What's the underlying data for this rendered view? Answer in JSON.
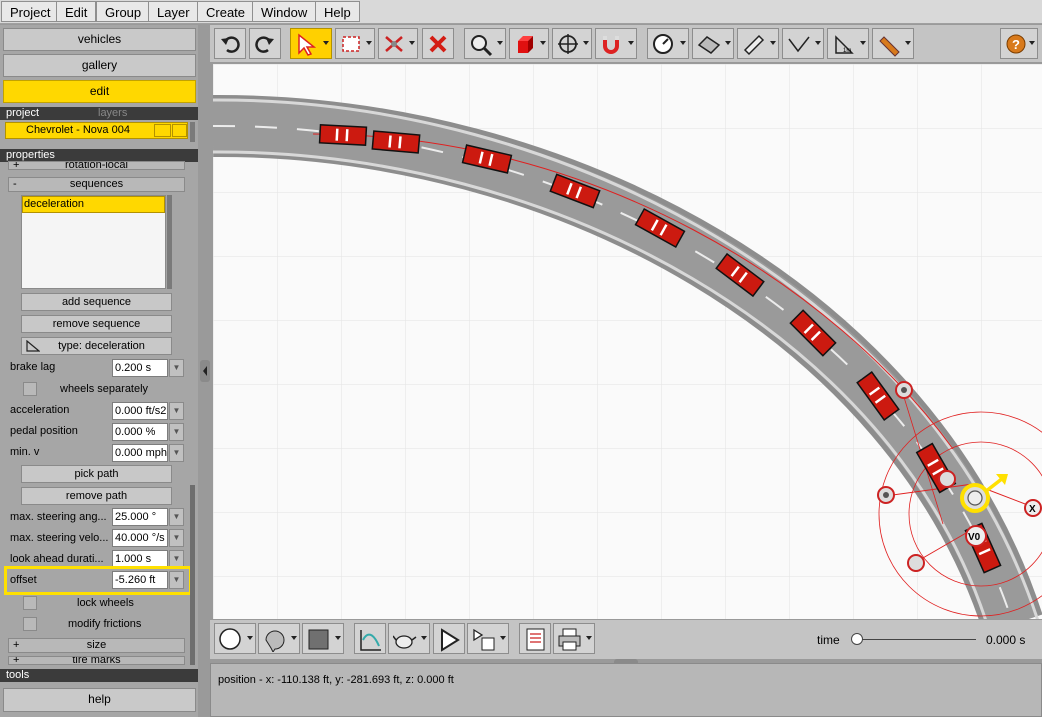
{
  "menu": [
    "Project",
    "Edit",
    "Group",
    "Layer",
    "Create",
    "Window",
    "Help"
  ],
  "nav": {
    "vehicles": "vehicles",
    "gallery": "gallery",
    "edit": "edit"
  },
  "project_tabs": {
    "project": "project",
    "layers": "layers"
  },
  "vehicle_name": "Chevrolet - Nova 004",
  "properties_title": "properties",
  "sections": {
    "rotation_local": "rotation-local",
    "sequences": "sequences",
    "size": "size",
    "tire_marks": "tire marks"
  },
  "sequence_list": [
    "deceleration"
  ],
  "buttons": {
    "add_sequence": "add sequence",
    "remove_sequence": "remove sequence",
    "type": "type: deceleration",
    "pick_path": "pick path",
    "remove_path": "remove path",
    "help": "help"
  },
  "properties": {
    "brake_lag": {
      "label": "brake lag",
      "value": "0.200 s"
    },
    "wheels_separately": "wheels separately",
    "acceleration": {
      "label": "acceleration",
      "value": "0.000 ft/s2"
    },
    "pedal_position": {
      "label": "pedal position",
      "value": "0.000 %"
    },
    "min_v": {
      "label": "min. v",
      "value": "0.000 mph"
    },
    "max_steering_angle": {
      "label": "max. steering ang...",
      "value": "25.000 °"
    },
    "max_steering_velocity": {
      "label": "max. steering velo...",
      "value": "40.000 °/s"
    },
    "look_ahead": {
      "label": "look ahead durati...",
      "value": "1.000 s"
    },
    "offset": {
      "label": "offset",
      "value": "-5.260 ft"
    },
    "lock_wheels": "lock wheels",
    "modify_frictions": "modify frictions"
  },
  "tools_title": "tools",
  "time": {
    "label": "time",
    "value": "0.000 s",
    "slider_fraction": 0
  },
  "status": "position - x: -110.138 ft, y: -281.693 ft, z: 0.000 ft",
  "canvas_markers": {
    "v0": "V0",
    "x": "X"
  },
  "colors": {
    "accent": "#ffd800",
    "highlight_border": "#ffe000",
    "car_red": "#cc1a10",
    "path_red": "#e02020"
  },
  "icons": [
    "undo-icon",
    "redo-icon",
    "select-icon",
    "rectangle-select-icon",
    "remove-path-icon",
    "delete-icon",
    "zoom-icon",
    "box-icon",
    "move-icon",
    "magnet-icon",
    "gauge-icon",
    "road-icon",
    "ruler-icon",
    "angle-icon",
    "measure-icon",
    "tape-icon",
    "help-icon",
    "circle-icon",
    "shape-icon",
    "fill-icon",
    "chart-icon",
    "teapot-icon",
    "play-icon",
    "playlist-icon",
    "report-icon",
    "print-icon"
  ]
}
